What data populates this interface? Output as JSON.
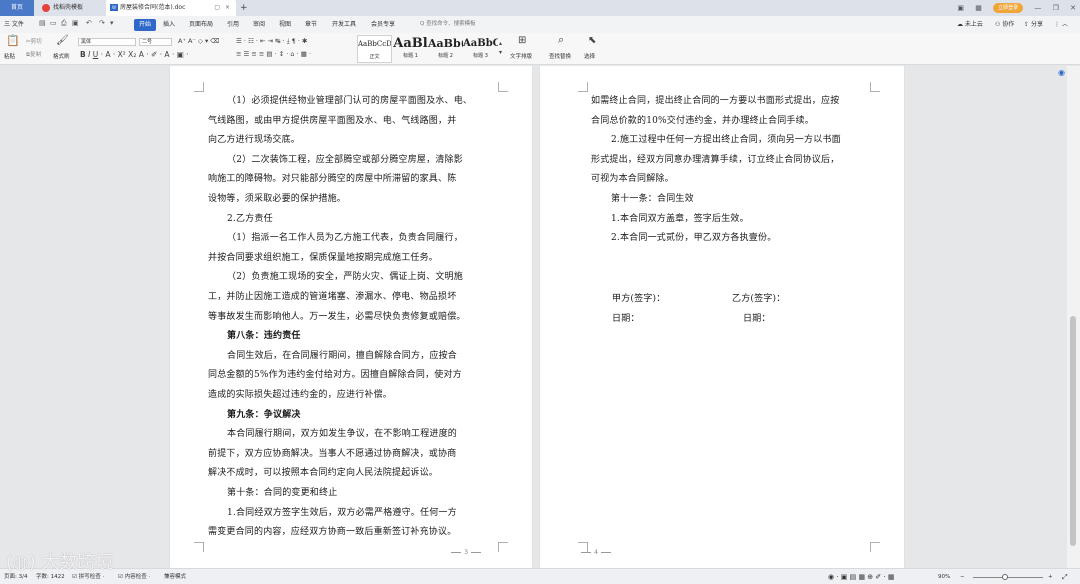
{
  "tabs": {
    "home": "首页",
    "template": "找稻壳模板",
    "doc_icon": "W",
    "document": "房屋装修合同(范本).doc",
    "add": "+"
  },
  "window": {
    "login": "立即登录",
    "icons": [
      "window-layout-icon",
      "grid-icon",
      "minimize-icon",
      "restore-icon",
      "close-icon"
    ]
  },
  "menubar": {
    "file": "三 文件",
    "start": "开始",
    "items": [
      "插入",
      "页面布局",
      "引用",
      "审阅",
      "视图",
      "章节",
      "开发工具",
      "会员专享"
    ],
    "search_placeholder": "Q 查找命令、搜索模板",
    "cloud": "未上云",
    "collab": "协作",
    "share": "分享"
  },
  "ribbon": {
    "paste": "粘贴",
    "cut": "剪切",
    "copy": "复制",
    "format_painter": "格式刷",
    "font_name": "黑体",
    "font_size": "二号",
    "styles": [
      {
        "sample": "AaBbCcDd",
        "label": "正文"
      },
      {
        "sample": "AaBl",
        "label": "标题 1"
      },
      {
        "sample": "AaBb(",
        "label": "标题 2"
      },
      {
        "sample": "AaBbC",
        "label": "标题 3"
      }
    ],
    "text_layout": "文字排版",
    "find_replace": "查找替换",
    "select": "选择"
  },
  "left_page": {
    "paragraphs": [
      "（1）必须提供经物业管理部门认可的房屋平面图及水、电、",
      "气线路图，或由甲方提供房屋平面图及水、电、气线路图，并",
      "向乙方进行现场交底。",
      "（2）二次装饰工程，应全部腾空或部分腾空房屋，清除影",
      "响施工的障碍物。对只能部分腾空的房屋中所滞留的家具、陈",
      "设物等，须采取必要的保护措施。",
      "2.乙方责任",
      "（1）指派一名工作人员为乙方施工代表，负责合同履行，",
      "并按合同要求组织施工，保质保量地按期完成施工任务。",
      "（2）负责施工现场的安全，严防火灾、偶证上岗、文明施",
      "工，并防止因施工造成的管道堵塞、渗漏水、停电、物品损坏",
      "等事故发生而影响他人。万一发生，必需尽快负责修复或赔偿。",
      "第八条：违约责任",
      "合同生效后，在合同履行期间，擅自解除合同方，应按合",
      "同总金额的5%作为违约金付给对方。因擅自解除合同，使对方",
      "造成的实际损失超过违约金的，应进行补偿。",
      "第九条：争议解决",
      "本合同履行期间，双方如发生争议，在不影响工程进度的",
      "前提下，双方应协商解决。当事人不愿通过协商解决，或协商",
      "解决不成时，可以按照本合同约定向人民法院提起诉讼。",
      "第十条：合同的变更和终止",
      "1.合同经双方签字生效后，双方必需严格遵守。任何一方",
      "需变更合同的内容，应经双方协商一致后重新签订补充协议。"
    ],
    "page_number": "3"
  },
  "right_page": {
    "paragraphs": [
      "如需终止合同，提出终止合同的一方要以书面形式提出，应按",
      "合同总价款的10%交付违约金，并办理终止合同手续。",
      "2.施工过程中任何一方提出终止合同，须向另一方以书面",
      "形式提出，经双方同意办理清算手续，订立终止合同协议后，",
      "可视为本合同解除。",
      "第十一条：合同生效",
      "1.本合同双方盖章，签字后生效。",
      "2.本合同一式贰份，甲乙双方各执壹份。"
    ],
    "sign_a": "甲方(签字)：",
    "sign_b": "乙方(签字)：",
    "date_a": "日期：",
    "date_b": "日期：",
    "page_number": "4"
  },
  "statusbar": {
    "page": "页面: 3/4",
    "words": "字数: 1422",
    "spell": "拼写检查 ·",
    "content_check": "内容检查 ·",
    "compat": "兼容模式",
    "zoom": "90%",
    "zoom_level": 0.45
  },
  "watermark": "大数跨境"
}
